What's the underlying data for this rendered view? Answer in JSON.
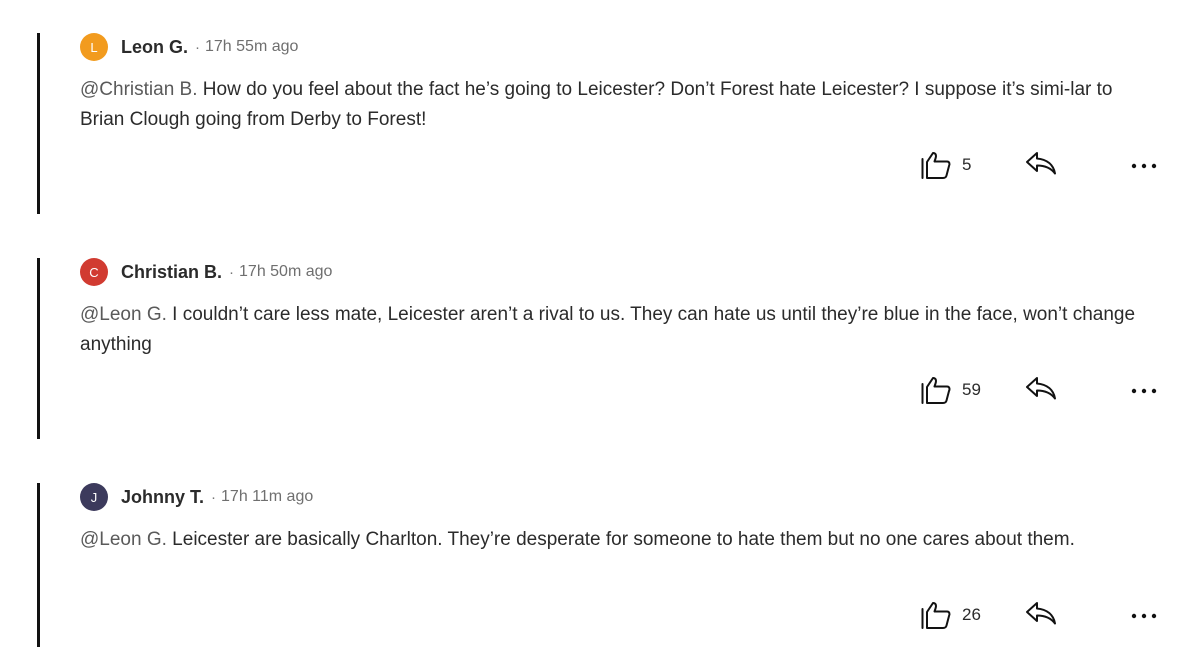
{
  "comments": [
    {
      "author": "Leon G.",
      "initial": "L",
      "avatar_color": "#f29b1e",
      "separator": "·",
      "time": "17h 55m ago",
      "mention": "@Christian B.",
      "text": " How do you feel about the fact he’s going to Leicester? Don’t Forest hate Leicester? I suppose it’s simi-lar to Brian Clough going from Derby to Forest!",
      "likes": "5"
    },
    {
      "author": "Christian B.",
      "initial": "C",
      "avatar_color": "#d13b31",
      "separator": "·",
      "time": "17h 50m ago",
      "mention": "@Leon G.",
      "text": " I couldn’t care less mate, Leicester aren’t a rival to us. They can hate us until they’re blue in the face, won’t change anything",
      "likes": "59"
    },
    {
      "author": "Johnny T.",
      "initial": "J",
      "avatar_color": "#3c3a5c",
      "separator": "·",
      "time": "17h 11m ago",
      "mention": "@Leon G.",
      "text": " Leicester are basically Charlton. They’re desperate for someone to hate them but no one cares about them.",
      "likes": "26"
    }
  ],
  "icons": {
    "like": "thumbs-up-icon",
    "reply": "reply-arrow-icon",
    "more": "more-options-icon"
  }
}
